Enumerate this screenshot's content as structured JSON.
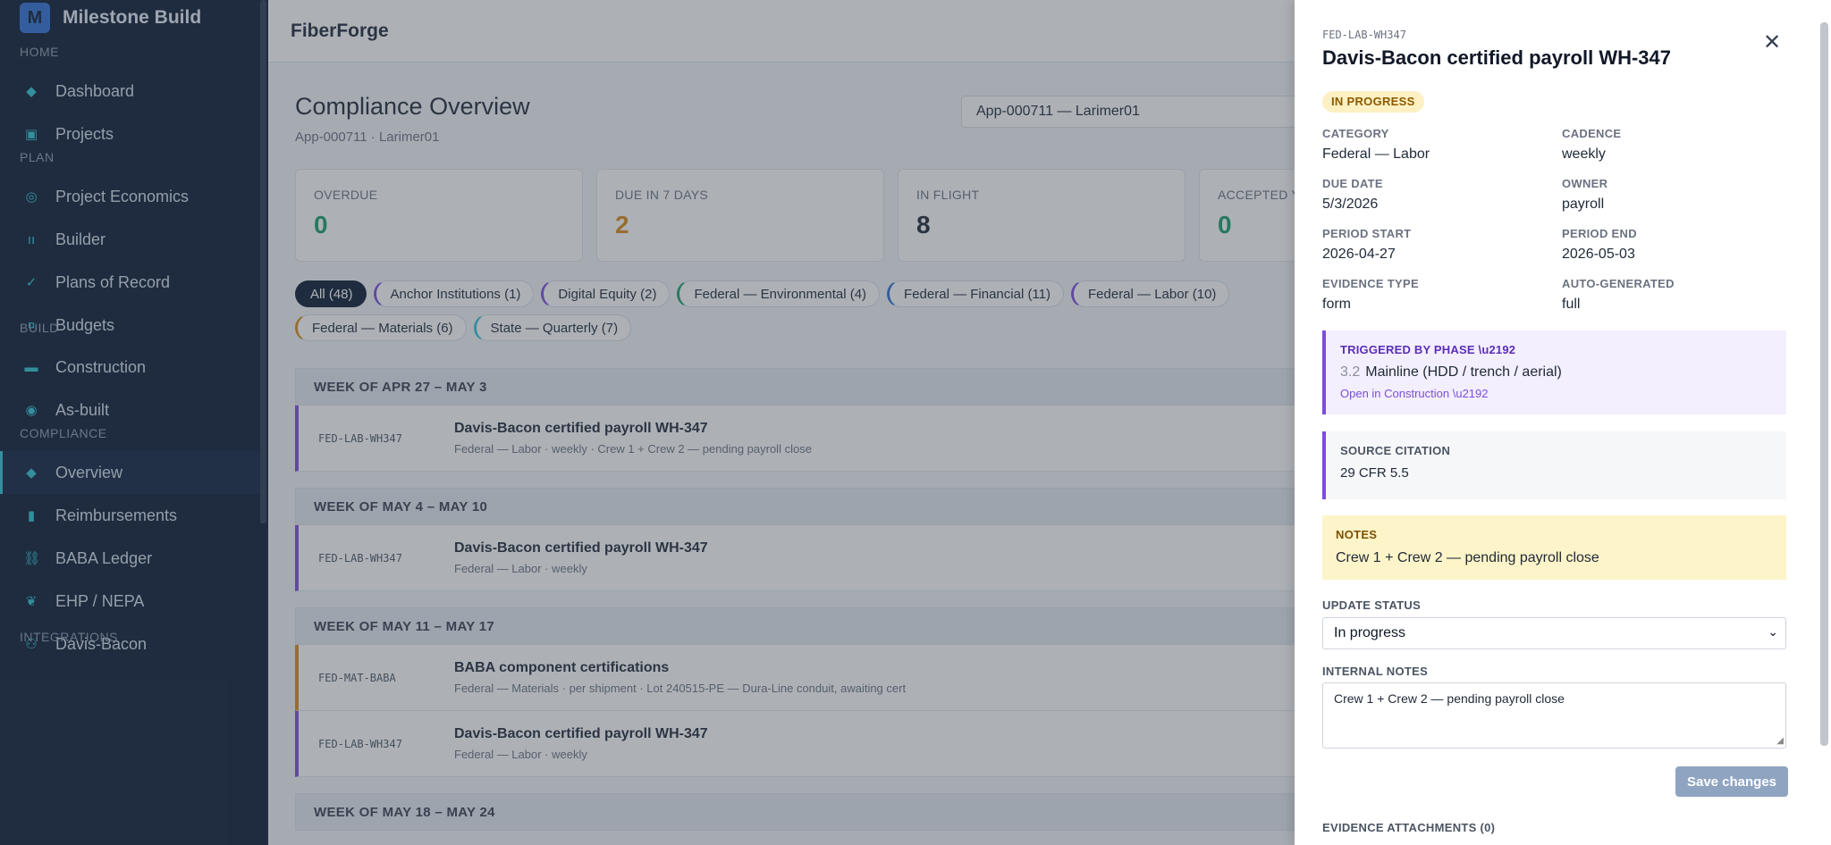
{
  "brand": {
    "logo_letter": "M",
    "name": "Milestone Build"
  },
  "sidebar": {
    "sections": [
      {
        "label": "HOME",
        "items": [
          {
            "label": "Dashboard",
            "icon": "diamond-icon",
            "glyph": "◆"
          },
          {
            "label": "Projects",
            "icon": "square-icon",
            "glyph": "▣"
          }
        ]
      },
      {
        "label": "PLAN",
        "items": [
          {
            "label": "Project Economics",
            "icon": "target-icon",
            "glyph": "◎"
          },
          {
            "label": "Builder",
            "icon": "columns-icon",
            "glyph": "ıı"
          },
          {
            "label": "Plans of Record",
            "icon": "check-icon",
            "glyph": "✓"
          },
          {
            "label": "Budgets",
            "icon": "currency-icon",
            "glyph": "¤"
          }
        ]
      },
      {
        "label": "BUILD",
        "items": [
          {
            "label": "Construction",
            "icon": "truck-icon",
            "glyph": "▬"
          },
          {
            "label": "As-built",
            "icon": "dot-icon",
            "glyph": "◉"
          }
        ]
      },
      {
        "label": "COMPLIANCE",
        "items": [
          {
            "label": "Overview",
            "icon": "diamond-icon",
            "glyph": "◆",
            "active": true
          },
          {
            "label": "Reimbursements",
            "icon": "receipt-icon",
            "glyph": "▮"
          },
          {
            "label": "BABA Ledger",
            "icon": "link-icon",
            "glyph": "⛓"
          },
          {
            "label": "EHP / NEPA",
            "icon": "leaf-icon",
            "glyph": "❦"
          },
          {
            "label": "Davis-Bacon",
            "icon": "people-icon",
            "glyph": "⚇"
          }
        ]
      },
      {
        "label": "INTEGRATIONS",
        "items": []
      }
    ]
  },
  "topbar": {
    "title": "FiberForge"
  },
  "page": {
    "title": "Compliance Overview",
    "subtitle": "App-000711 · Larimer01",
    "app_select": "App-000711 — Larimer01"
  },
  "stats": [
    {
      "label": "OVERDUE",
      "value": "0",
      "color": "#1a9d6b"
    },
    {
      "label": "DUE IN 7 DAYS",
      "value": "2",
      "color": "#d98a1c"
    },
    {
      "label": "IN FLIGHT",
      "value": "8",
      "color": "#1f2937"
    },
    {
      "label": "ACCEPTED YTD",
      "value": "0",
      "color": "#1a9d6b"
    }
  ],
  "chips": [
    {
      "label": "All (48)",
      "all": true,
      "color": "#0b1a33"
    },
    {
      "label": "Anchor Institutions (1)",
      "color": "#7c4ddb"
    },
    {
      "label": "Digital Equity (2)",
      "color": "#7c4ddb"
    },
    {
      "label": "Federal — Environmental (4)",
      "color": "#1a9d6b"
    },
    {
      "label": "Federal — Financial (11)",
      "color": "#2f6fd6"
    },
    {
      "label": "Federal — Labor (10)",
      "color": "#7c4ddb"
    },
    {
      "label": "Federal — Materials (6)",
      "color": "#d98a1c"
    },
    {
      "label": "State — Quarterly (7)",
      "color": "#2ec5d3"
    }
  ],
  "weeks": [
    {
      "label": "WEEK OF APR 27 – MAY 3",
      "rows": [
        {
          "code": "FED-LAB-WH347",
          "title": "Davis-Bacon certified payroll WH-347",
          "meta": "Federal — Labor · weekly · Crew 1 + Crew 2 — pending payroll close",
          "color": "#7c4ddb"
        }
      ]
    },
    {
      "label": "WEEK OF MAY 4 – MAY 10",
      "rows": [
        {
          "code": "FED-LAB-WH347",
          "title": "Davis-Bacon certified payroll WH-347",
          "meta": "Federal — Labor · weekly",
          "color": "#7c4ddb"
        }
      ]
    },
    {
      "label": "WEEK OF MAY 11 – MAY 17",
      "rows": [
        {
          "code": "FED-MAT-BABA",
          "title": "BABA component certifications",
          "meta": "Federal — Materials · per shipment · Lot 240515-PE — Dura-Line conduit, awaiting cert",
          "color": "#d98a1c"
        },
        {
          "code": "FED-LAB-WH347",
          "title": "Davis-Bacon certified payroll WH-347",
          "meta": "Federal — Labor · weekly",
          "color": "#7c4ddb"
        }
      ]
    },
    {
      "label": "WEEK OF MAY 18 – MAY 24",
      "rows": []
    }
  ],
  "drawer": {
    "code": "FED-LAB-WH347",
    "title": "Davis-Bacon certified payroll WH-347",
    "status_badge": "IN PROGRESS",
    "close_glyph": "✕",
    "fields": [
      {
        "label": "CATEGORY",
        "value": "Federal — Labor"
      },
      {
        "label": "CADENCE",
        "value": "weekly"
      },
      {
        "label": "DUE DATE",
        "value": "5/3/2026"
      },
      {
        "label": "OWNER",
        "value": "payroll"
      },
      {
        "label": "PERIOD START",
        "value": "2026-04-27"
      },
      {
        "label": "PERIOD END",
        "value": "2026-05-03"
      },
      {
        "label": "EVIDENCE TYPE",
        "value": "form"
      },
      {
        "label": "AUTO-GENERATED",
        "value": "full"
      }
    ],
    "trigger": {
      "label": "TRIGGERED BY PHASE \\u2192",
      "phase_num": "3.2",
      "phase_name": "Mainline (HDD / trench / aerial)",
      "link": "Open in Construction \\u2192"
    },
    "source": {
      "label": "SOURCE CITATION",
      "value": "29 CFR 5.5"
    },
    "notes": {
      "label": "NOTES",
      "value": "Crew 1 + Crew 2 — pending payroll close"
    },
    "update_status": {
      "label": "UPDATE STATUS",
      "value": "In progress"
    },
    "internal_notes": {
      "label": "INTERNAL NOTES",
      "value": "Crew 1 + Crew 2 — pending payroll close"
    },
    "save_label": "Save changes",
    "attachments_label": "EVIDENCE ATTACHMENTS (0)"
  }
}
